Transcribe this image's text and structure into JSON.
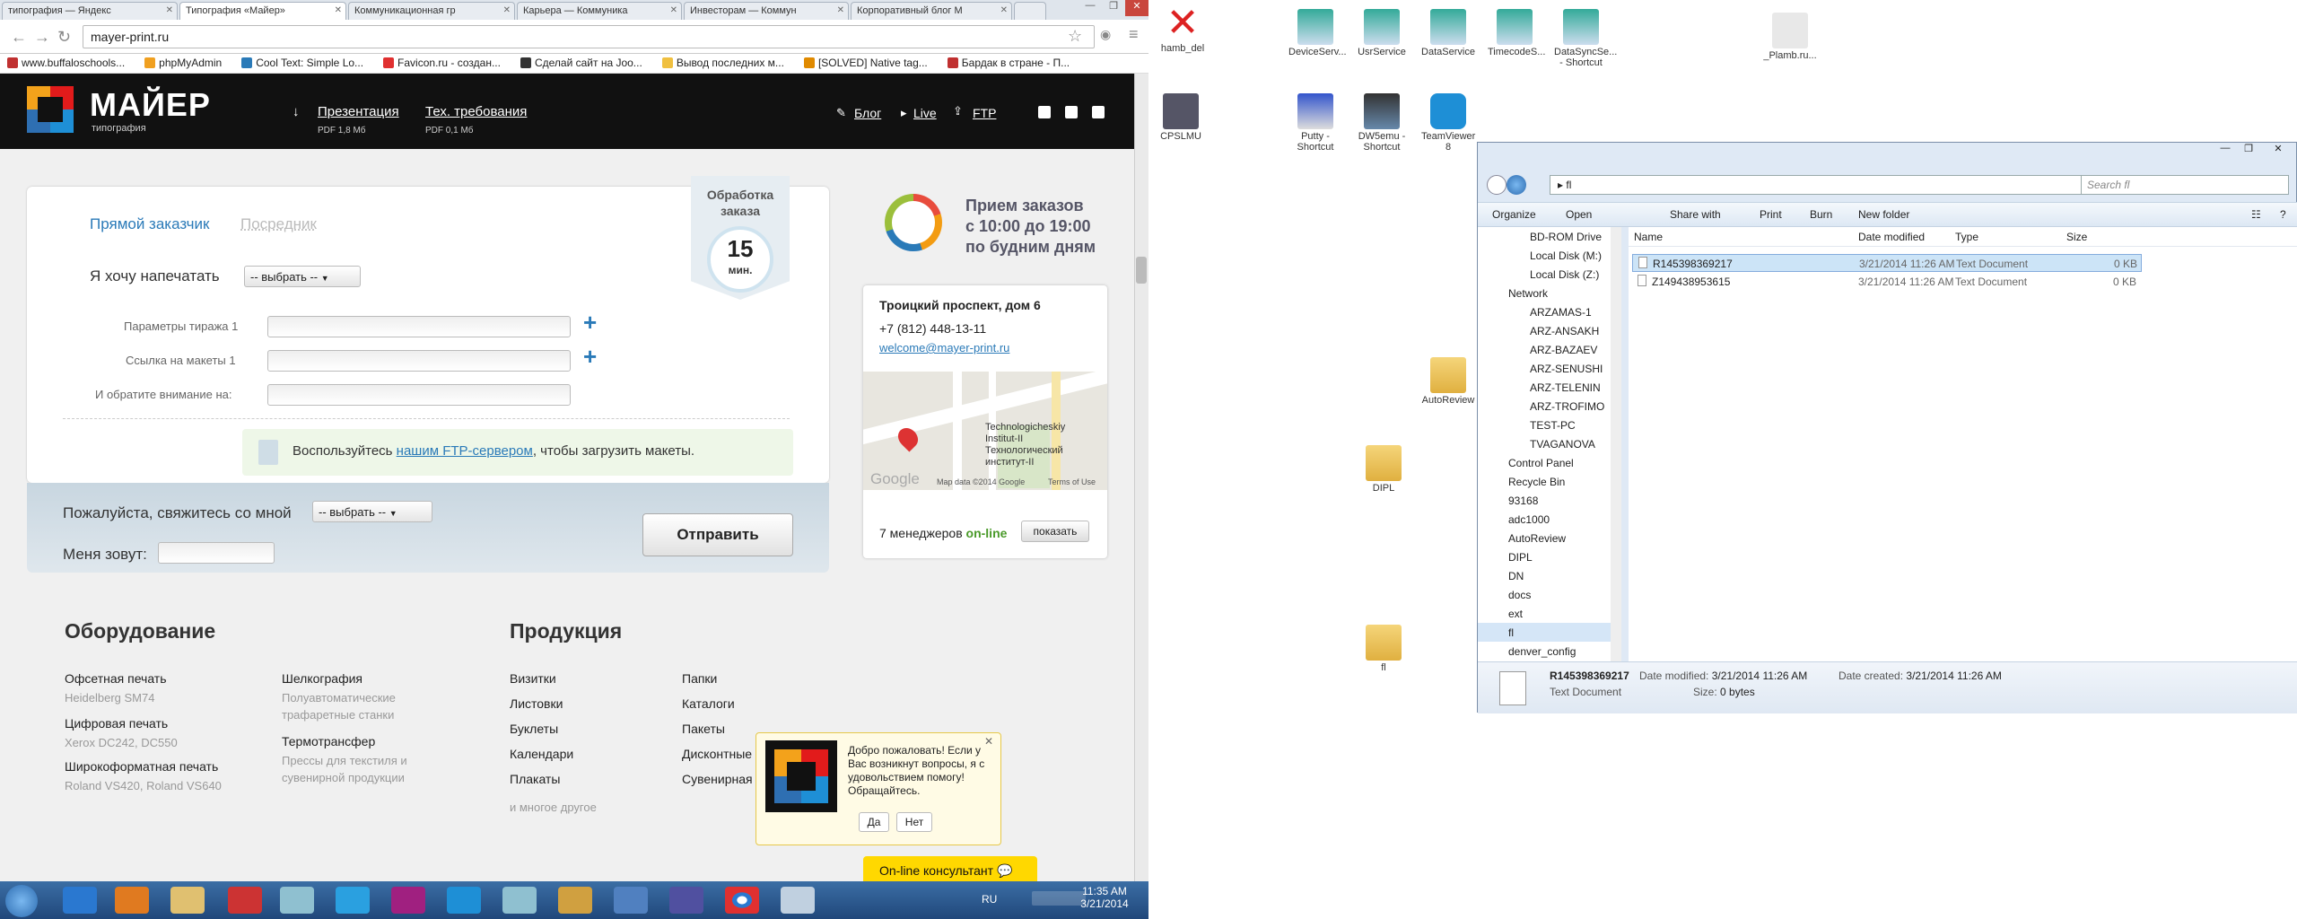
{
  "browser": {
    "tabs": [
      {
        "label": "типография — Яндекс"
      },
      {
        "label": "Типография «Майер»"
      },
      {
        "label": "Коммуникационная гр"
      },
      {
        "label": "Карьера — Коммуника"
      },
      {
        "label": "Инвесторам — Коммун"
      },
      {
        "label": "Корпоративный блог М"
      }
    ],
    "url": "mayer-print.ru",
    "bookmarks": [
      {
        "label": "www.buffaloschools...",
        "color": "#c03030"
      },
      {
        "label": "phpMyAdmin",
        "color": "#f0a020"
      },
      {
        "label": "Cool Text: Simple Lo...",
        "color": "#2a7ab8"
      },
      {
        "label": "Favicon.ru - создан...",
        "color": "#e03030"
      },
      {
        "label": "Сделай сайт на Joo...",
        "color": "#333333"
      },
      {
        "label": "Вывод последних м...",
        "color": "#f0c040"
      },
      {
        "label": "[SOLVED] Native tag...",
        "color": "#e08a00"
      },
      {
        "label": "Бардак в стране - П...",
        "color": "#c03030"
      }
    ]
  },
  "site": {
    "logo": {
      "name": "МАЙЕР",
      "sub": "типография"
    },
    "header_links": [
      {
        "label": "Презентация",
        "sub": "PDF 1,8 Мб"
      },
      {
        "label": "Тех. требования",
        "sub": "PDF 0,1 Мб"
      }
    ],
    "nav_links": {
      "blog": "Блог",
      "live": "Live",
      "ftp": "FTP"
    },
    "form": {
      "tab_direct": "Прямой заказчик",
      "tab_agent": "Посредник",
      "want_print_label": "Я хочу напечатать",
      "select_placeholder": "-- выбрать --",
      "params_label": "Параметры тиража 1",
      "layouts_label": "Ссылка на макеты 1",
      "attention_label": "И обратите внимание на:",
      "ftp_note_pre": "Воспользуйтесь ",
      "ftp_note_link": "нашим FTP-сервером",
      "ftp_note_post": ", чтобы загрузить макеты.",
      "contact_label": "Пожалуйста, свяжитесь со мной",
      "contact_select": "-- выбрать --",
      "name_label": "Меня зовут:",
      "submit_label": "Отправить"
    },
    "badge": {
      "title": "Обработка заказа",
      "number": "15",
      "unit": "мин."
    },
    "hours": {
      "line1": "Прием заказов",
      "line2": "с 10:00 до 19:00",
      "line3": "по будним дням"
    },
    "contact": {
      "address": "Троицкий проспект, дом 6",
      "phone": "+7 (812) 448-13-11",
      "email": "welcome@mayer-print.ru",
      "map_label1": "Technologicheskiy",
      "map_label2": "Institut-II",
      "map_label3": "Технологический",
      "map_label4": "институт-II",
      "map_footer": "Map data ©2014 Google",
      "map_terms": "Terms of Use",
      "map_google": "Google",
      "managers_pre": "7 менеджеров",
      "managers_online": "on-line",
      "show_button": "показать"
    },
    "equipment": {
      "title": "Оборудование",
      "col1": [
        {
          "name": "Офсетная печать",
          "sub": "Heidelberg SM74"
        },
        {
          "name": "Цифровая печать",
          "sub": "Xerox DC242, DC550"
        },
        {
          "name": "Широкоформатная печать",
          "sub": "Roland VS420, Roland VS640"
        }
      ],
      "col2": [
        {
          "name": "Шелкография",
          "sub1": "Полуавтоматические",
          "sub2": "трафаретные станки"
        },
        {
          "name": "Термотрансфер",
          "sub1": "Прессы для текстиля и",
          "sub2": "сувенирной продукции"
        }
      ]
    },
    "products": {
      "title": "Продукция",
      "col1": [
        "Визитки",
        "Листовки",
        "Буклеты",
        "Календари",
        "Плакаты"
      ],
      "more": "и многое другое",
      "col2": [
        "Папки",
        "Каталоги",
        "Пакеты",
        "Дисконтные",
        "Сувенирная"
      ]
    },
    "popup": {
      "text": "Добро пожаловать! Если у Вас возникнут вопросы, я с удовольствием помогу! Обращайтесь.",
      "yes": "Да",
      "no": "Нет"
    },
    "consultant": "On-line консультант"
  },
  "taskbar": {
    "lang": "RU",
    "time": "11:35 AM",
    "date": "3/21/2014"
  },
  "desktop_icons": [
    {
      "label": "hamb_del"
    },
    {
      "label": "DeviceServ..."
    },
    {
      "label": "UsrService"
    },
    {
      "label": "DataService"
    },
    {
      "label": "TimecodeS..."
    },
    {
      "label": "DataSyncSe... - Shortcut"
    },
    {
      "label": "_Plamb.ru..."
    },
    {
      "label": "CPSLMU"
    },
    {
      "label": "Putty - Shortcut"
    },
    {
      "label": "DW5emu - Shortcut"
    },
    {
      "label": "TeamViewer 8"
    },
    {
      "label": "AutoReview"
    },
    {
      "label": "DIPL"
    },
    {
      "label": "fl"
    }
  ],
  "explorer": {
    "path": "fl",
    "search_placeholder": "Search fl",
    "commands": {
      "organize": "Organize",
      "open": "Open",
      "share": "Share with",
      "print": "Print",
      "burn": "Burn",
      "new_folder": "New folder"
    },
    "nav": [
      "BD-ROM Drive",
      "Local Disk (M:)",
      "Local Disk (Z:)",
      "Network",
      "ARZAMAS-1",
      "ARZ-ANSAKH",
      "ARZ-BAZAEV",
      "ARZ-SENUSHI",
      "ARZ-TELENIN",
      "ARZ-TROFIMO",
      "TEST-PC",
      "TVAGANOVA",
      "Control Panel",
      "Recycle Bin",
      "93168",
      "adc1000",
      "AutoReview",
      "DIPL",
      "DN",
      "docs",
      "ext",
      "fl",
      "denver_config"
    ],
    "columns": {
      "name": "Name",
      "date": "Date modified",
      "type": "Type",
      "size": "Size"
    },
    "files": [
      {
        "name": "R145398369217",
        "date": "3/21/2014 11:26 AM",
        "type": "Text Document",
        "size": "0 KB"
      },
      {
        "name": "Z149438953615",
        "date": "3/21/2014 11:26 AM",
        "type": "Text Document",
        "size": "0 KB"
      }
    ],
    "details": {
      "name": "R145398369217",
      "type": "Text Document",
      "modified_label": "Date modified:",
      "modified": "3/21/2014 11:26 AM",
      "created_label": "Date created:",
      "created": "3/21/2014 11:26 AM",
      "size_label": "Size:",
      "size": "0 bytes"
    }
  }
}
